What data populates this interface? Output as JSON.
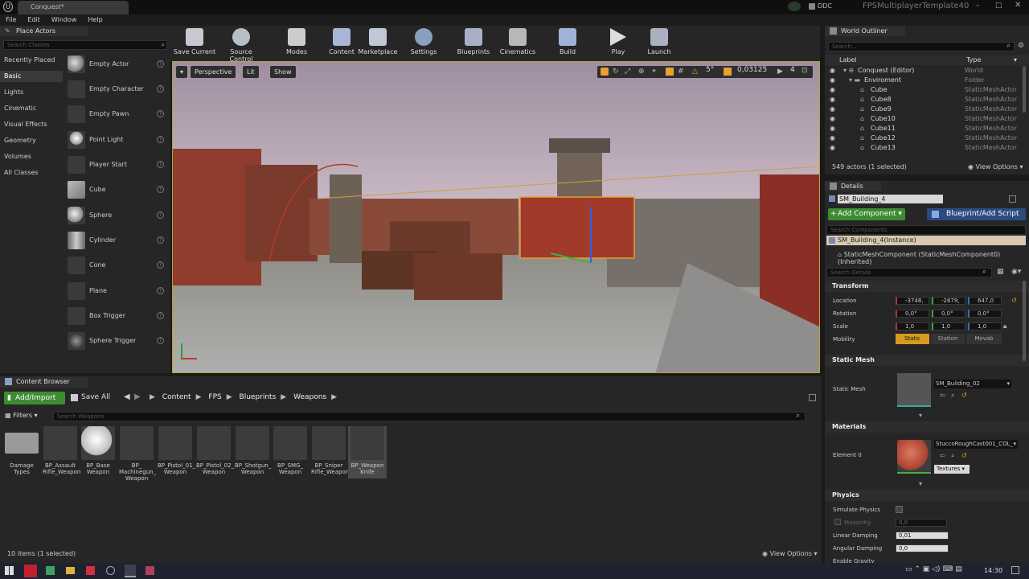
{
  "titlebar": {
    "tab_title": "Conquest*",
    "ddc_label": "DDC",
    "project_name": "FPSMultiplayerTemplate40"
  },
  "menu": [
    "File",
    "Edit",
    "Window",
    "Help"
  ],
  "place_actors": {
    "tab_label": "Place Actors",
    "search_placeholder": "Search Classes",
    "categories": [
      "Recently Placed",
      "Basic",
      "Lights",
      "Cinematic",
      "Visual Effects",
      "Geometry",
      "Volumes",
      "All Classes"
    ],
    "selected_category": "Basic",
    "items": [
      "Empty Actor",
      "Empty Character",
      "Empty Pawn",
      "Point Light",
      "Player Start",
      "Cube",
      "Sphere",
      "Cylinder",
      "Cone",
      "Plane",
      "Box Trigger",
      "Sphere Trigger"
    ]
  },
  "toolbar": {
    "buttons": [
      {
        "label": "Save Current",
        "icon": "save-icon"
      },
      {
        "label": "Source Control",
        "icon": "source-control-icon"
      },
      {
        "label": "Modes",
        "icon": "modes-icon"
      },
      {
        "label": "Content",
        "icon": "content-icon"
      },
      {
        "label": "Marketplace",
        "icon": "marketplace-icon"
      },
      {
        "label": "Settings",
        "icon": "settings-icon"
      },
      {
        "label": "Blueprints",
        "icon": "blueprints-icon"
      },
      {
        "label": "Cinematics",
        "icon": "cinematics-icon"
      },
      {
        "label": "Build",
        "icon": "build-icon"
      },
      {
        "label": "Play",
        "icon": "play-icon"
      },
      {
        "label": "Launch",
        "icon": "launch-icon"
      }
    ]
  },
  "viewport": {
    "perspective_label": "Perspective",
    "lit_label": "Lit",
    "show_label": "Show",
    "angle_snap": "5°",
    "scale_snap": "0,03125",
    "camera_speed": "4"
  },
  "content_browser": {
    "tab_label": "Content Browser",
    "add_import_label": "Add/Import",
    "save_all_label": "Save All",
    "path": [
      "Content",
      "FPS",
      "Blueprints",
      "Weapons"
    ],
    "filters_label": "Filters",
    "search_placeholder": "Search Weapons",
    "assets": [
      "Damage Types",
      "BP_Assault Rifle_Weapon",
      "BP_Base Weapon",
      "BP_ Machinegun_ Weapon",
      "BP_Pistol_01_ Weapon",
      "BP_Pistol_02_ Weapon",
      "BP_Shotgun_ Weapon",
      "BP_SMG_ Weapon",
      "BP_Sniper Rifle_Weapon",
      "BP_Weapon Knife"
    ],
    "status": "10 items (1 selected)",
    "view_options_label": "View Options"
  },
  "outliner": {
    "tab_label": "World Outliner",
    "search_placeholder": "Search...",
    "col_label": "Label",
    "col_type": "Type",
    "rows": [
      {
        "label": "Conquest (Editor)",
        "type": "World"
      },
      {
        "label": "Enviroment",
        "type": "Folder"
      },
      {
        "label": "Cube",
        "type": "StaticMeshActor"
      },
      {
        "label": "Cube8",
        "type": "StaticMeshActor"
      },
      {
        "label": "Cube9",
        "type": "StaticMeshActor"
      },
      {
        "label": "Cube10",
        "type": "StaticMeshActor"
      },
      {
        "label": "Cube11",
        "type": "StaticMeshActor"
      },
      {
        "label": "Cube12",
        "type": "StaticMeshActor"
      },
      {
        "label": "Cube13",
        "type": "StaticMeshActor"
      }
    ],
    "status": "549 actors (1 selected)",
    "view_options_label": "View Options"
  },
  "details": {
    "tab_label": "Details",
    "object_name": "SM_Building_4",
    "add_component_label": "Add Component",
    "blueprint_label": "Blueprint/Add Script",
    "search_components_placeholder": "Search Components",
    "instance_label": "SM_Building_4(Instance)",
    "component_label": "StaticMeshComponent (StaticMeshComponent0) (Inherited)",
    "search_details_placeholder": "Search Details",
    "transform": {
      "title": "Transform",
      "location_label": "Location",
      "location": [
        "-3748,",
        "-2679,",
        "647,0"
      ],
      "rotation_label": "Rotation",
      "rotation": [
        "0,0°",
        "0,0°",
        "0,0°"
      ],
      "scale_label": "Scale",
      "scale": [
        "1,0",
        "1,0",
        "1,0"
      ],
      "mobility_label": "Mobility",
      "mobility_options": [
        "Static",
        "Station",
        "Movab"
      ]
    },
    "static_mesh": {
      "title": "Static Mesh",
      "label": "Static Mesh",
      "value": "SM_Building_02"
    },
    "materials": {
      "title": "Materials",
      "element_label": "Element 0",
      "value": "StuccoRoughCast001_COL_",
      "textures_label": "Textures"
    },
    "physics": {
      "title": "Physics",
      "simulate_label": "Simulate Physics",
      "mass_label": "MassInKg",
      "mass_value": "0,0",
      "linear_label": "Linear Damping",
      "linear_value": "0,01",
      "angular_label": "Angular Damping",
      "angular_value": "0,0",
      "gravity_label": "Enable Gravity"
    }
  },
  "taskbar": {
    "clock": "14:30"
  }
}
